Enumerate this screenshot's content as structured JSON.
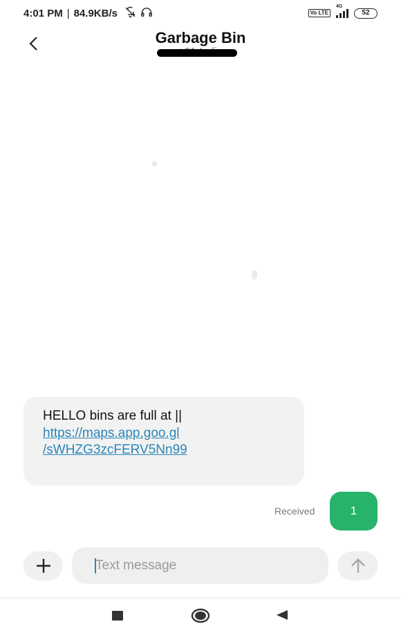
{
  "status_bar": {
    "time": "4:01 PM",
    "separator": "|",
    "speed": "84.9KB/s",
    "volte_label": "Vo LTE",
    "network_label": "4G",
    "battery_level": "52",
    "icons": [
      "bell-off-icon",
      "headphones-icon",
      "volte-icon",
      "signal-icon",
      "battery-icon"
    ]
  },
  "header": {
    "title": "Garbage Bin",
    "subtitle": "+91               India",
    "back_icon": "chevron-left-icon"
  },
  "messages": [
    {
      "direction": "incoming",
      "text": "HELLO bins are full at ||",
      "link_line1": "https://maps.app.goo.gl",
      "link_line2": "/sWHZG3zcFERV5Nn99"
    }
  ],
  "message_status": {
    "label": "Received",
    "sim_badge": "1",
    "sim_badge_color": "#27b36a"
  },
  "composer": {
    "placeholder": "Text message",
    "attach_icon": "plus-icon",
    "send_icon": "arrow-up-icon"
  },
  "nav_bar": {
    "icons": [
      "square-recents-icon",
      "circle-home-icon",
      "triangle-back-icon"
    ]
  },
  "colors": {
    "link": "#2b86b8",
    "bubble": "#f2f2f2",
    "accent": "#27b36a"
  }
}
